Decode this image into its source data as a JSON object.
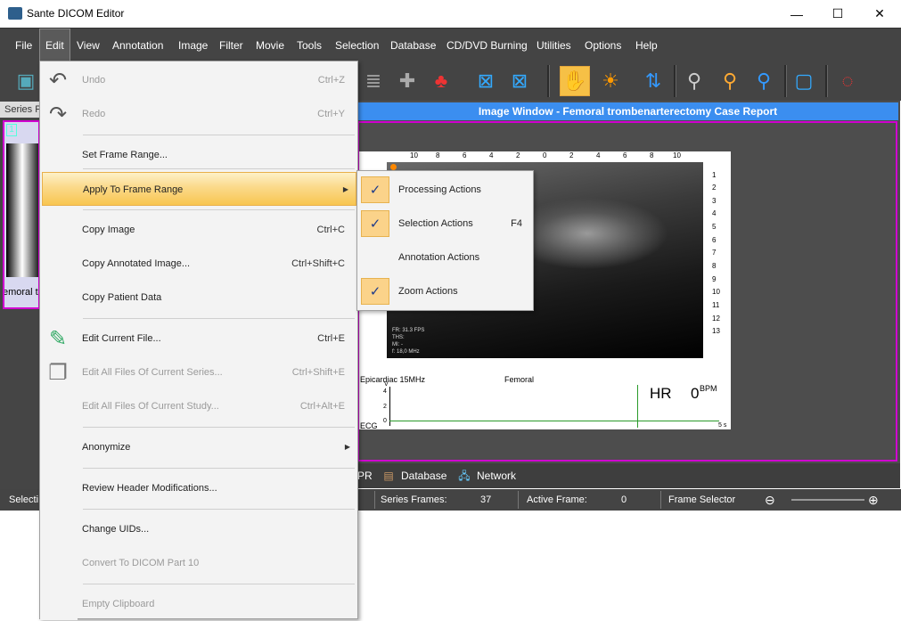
{
  "window": {
    "title": "Sante DICOM Editor",
    "controls": {
      "minimize": "—",
      "maximize": "☐",
      "close": "✕"
    }
  },
  "menubar": {
    "items": [
      "File",
      "Edit",
      "View",
      "Annotation",
      "Image",
      "Filter",
      "Movie",
      "Tools",
      "Selection",
      "Database",
      "CD/DVD Burning",
      "Utilities",
      "Options",
      "Help"
    ]
  },
  "series_panel": {
    "tab_label": "Series P",
    "thumb_number": "1",
    "thumb_caption": "emoral tr"
  },
  "image_window": {
    "title": "Image Window - Femoral trombenarterectomy Case Report",
    "ruler_ticks": [
      "10",
      "8",
      "6",
      "4",
      "2",
      "0",
      "2",
      "4",
      "6",
      "8",
      "10"
    ],
    "scale_ticks": [
      "1",
      "2",
      "3",
      "4",
      "5",
      "6",
      "7",
      "8",
      "9",
      "10",
      "11",
      "12",
      "13"
    ],
    "info_lines": [
      "FR: 31.3 FPS",
      "THS:",
      "MI: -",
      "f: 18,0 MHz"
    ],
    "probe_label": "Epicardiac 15MHz",
    "site_label": "Femoral",
    "hr_label": "HR",
    "hr_value": "0",
    "hr_unit": "BPM",
    "ecg_tag": "ECG",
    "ecg_duration": "5 s",
    "ecg_axis_unit": "V",
    "ecg_axis_ticks": [
      "4",
      "2",
      "0"
    ]
  },
  "bottom_tabs": {
    "partial": "PR",
    "database": "Database",
    "network": "Network"
  },
  "statusbar": {
    "left": "Selecti",
    "series_frames_label": "Series Frames:",
    "series_frames_value": "37",
    "active_frame_label": "Active Frame:",
    "active_frame_value": "0",
    "frame_selector_label": "Frame Selector"
  },
  "edit_menu": {
    "undo": {
      "label": "Undo",
      "shortcut": "Ctrl+Z"
    },
    "redo": {
      "label": "Redo",
      "shortcut": "Ctrl+Y"
    },
    "set_frame_range": {
      "label": "Set Frame Range..."
    },
    "apply_frame_range": {
      "label": "Apply To Frame Range"
    },
    "copy_image": {
      "label": "Copy Image",
      "shortcut": "Ctrl+C"
    },
    "copy_annotated": {
      "label": "Copy Annotated Image...",
      "shortcut": "Ctrl+Shift+C"
    },
    "copy_patient": {
      "label": "Copy Patient Data"
    },
    "edit_current": {
      "label": "Edit Current File...",
      "shortcut": "Ctrl+E"
    },
    "edit_series": {
      "label": "Edit All Files Of Current Series...",
      "shortcut": "Ctrl+Shift+E"
    },
    "edit_study": {
      "label": "Edit All Files Of Current Study...",
      "shortcut": "Ctrl+Alt+E"
    },
    "anonymize": {
      "label": "Anonymize"
    },
    "review_header": {
      "label": "Review Header Modifications..."
    },
    "change_uids": {
      "label": "Change UIDs..."
    },
    "convert_part10": {
      "label": "Convert To DICOM Part 10"
    },
    "empty_clipboard": {
      "label": "Empty Clipboard"
    }
  },
  "submenu": {
    "processing": {
      "label": "Processing Actions",
      "checked": true
    },
    "selection": {
      "label": "Selection Actions",
      "shortcut": "F4",
      "checked": true
    },
    "annotation": {
      "label": "Annotation Actions",
      "checked": false
    },
    "zoom": {
      "label": "Zoom Actions",
      "checked": true
    }
  },
  "colors": {
    "accent_blue": "#3b8ef0",
    "selection_magenta": "#d000d0",
    "menu_highlight": "#fbd98a",
    "dark_chrome": "#444444"
  }
}
